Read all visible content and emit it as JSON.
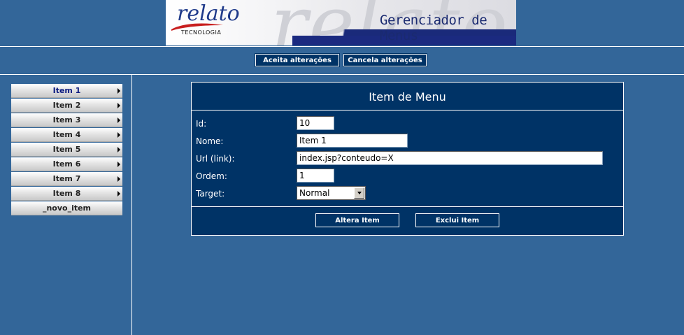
{
  "header": {
    "logo_text": "relato",
    "logo_subtext": "TECNOLOGIA",
    "app_title": "Gerenciador de Menus",
    "watermark": "relato"
  },
  "toolbar": {
    "accept_label": "Aceita alterações",
    "cancel_label": "Cancela alterações"
  },
  "sidebar": {
    "items": [
      {
        "label": "Item 1",
        "active": true
      },
      {
        "label": "Item 2"
      },
      {
        "label": "Item 3"
      },
      {
        "label": "Item 4"
      },
      {
        "label": "Item 5"
      },
      {
        "label": "Item 6"
      },
      {
        "label": "Item 7"
      },
      {
        "label": "Item 8"
      }
    ],
    "new_item_label": "_novo_item"
  },
  "form": {
    "title": "Item de Menu",
    "fields": {
      "id": {
        "label": "Id:",
        "value": "10"
      },
      "name": {
        "label": "Nome:",
        "value": "Item 1"
      },
      "url": {
        "label": "Url (link):",
        "value": "index.jsp?conteudo=X"
      },
      "order": {
        "label": "Ordem:",
        "value": "1"
      },
      "target": {
        "label": "Target:",
        "value": "Normal"
      }
    },
    "alter_button": "Altera Item",
    "delete_button": "Exclui Item"
  },
  "colors": {
    "background": "#336699",
    "panel": "#003366",
    "accent": "#1b2a80"
  }
}
